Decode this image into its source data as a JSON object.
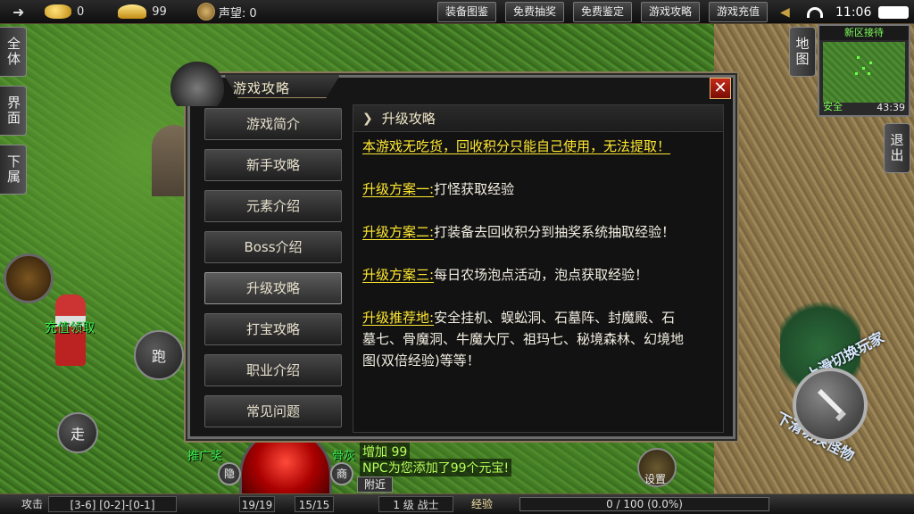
{
  "topbar": {
    "gold": "0",
    "ingot": "99",
    "reputation": "声望: 0",
    "buttons": [
      "装备图鉴",
      "免费抽奖",
      "免费鉴定",
      "游戏攻略",
      "游戏充值"
    ],
    "time": "11:06"
  },
  "left_tabs": [
    "全体",
    "界面",
    "下属"
  ],
  "right_tabs": [
    "地图",
    "退出"
  ],
  "minimap": {
    "title": "新区接待",
    "safe": "安全",
    "coords": "43:39"
  },
  "world": {
    "npc_label": "充值领取",
    "run_label": "跑",
    "walk_label": "走",
    "ring_text_top": "上滑切换玩家",
    "ring_text_bottom": "下滑切换怪物"
  },
  "hud": {
    "chat_line1": "增加 99",
    "chat_line2": "NPC为您添加了99个元宝!",
    "nearby": "附近",
    "promo_label": "推广奖",
    "bone_label": "骨灰",
    "hide_label": "隐",
    "shop_label": "商",
    "settings": "设置",
    "attack": "攻击",
    "attack_vals": "[3-6] [0-2]-[0-1]",
    "hp": "19/19",
    "mp": "15/15",
    "level": "1 级 战士",
    "exp_label": "经验",
    "exp_value": "0 / 100 (0.0%)"
  },
  "dialog": {
    "title": "游戏攻略",
    "close": "✕",
    "menu": [
      "游戏简介",
      "新手攻略",
      "元素介绍",
      "Boss介绍",
      "升级攻略",
      "打宝攻略",
      "职业介绍",
      "常见问题"
    ],
    "active_index": 4,
    "content_title": "升级攻略",
    "intro": "本游戏无吃货，回收积分只能自己使用，无法提取！",
    "plan1_label": "升级方案一:",
    "plan1_text": "打怪获取经验",
    "plan2_label": "升级方案二:",
    "plan2_text": "打装备去回收积分到抽奖系统抽取经验！",
    "plan3_label": "升级方案三:",
    "plan3_text": "每日农场泡点活动，泡点获取经验！",
    "rec_label": "升级推荐地:",
    "rec_text_1": "安全挂机、蜈蚣洞、石墓阵、封魔殿、石",
    "rec_text_2": "墓七、骨魔洞、牛魔大厅、祖玛七、秘境森林、幻境地",
    "rec_text_3": "图(双倍经验)等等！"
  }
}
